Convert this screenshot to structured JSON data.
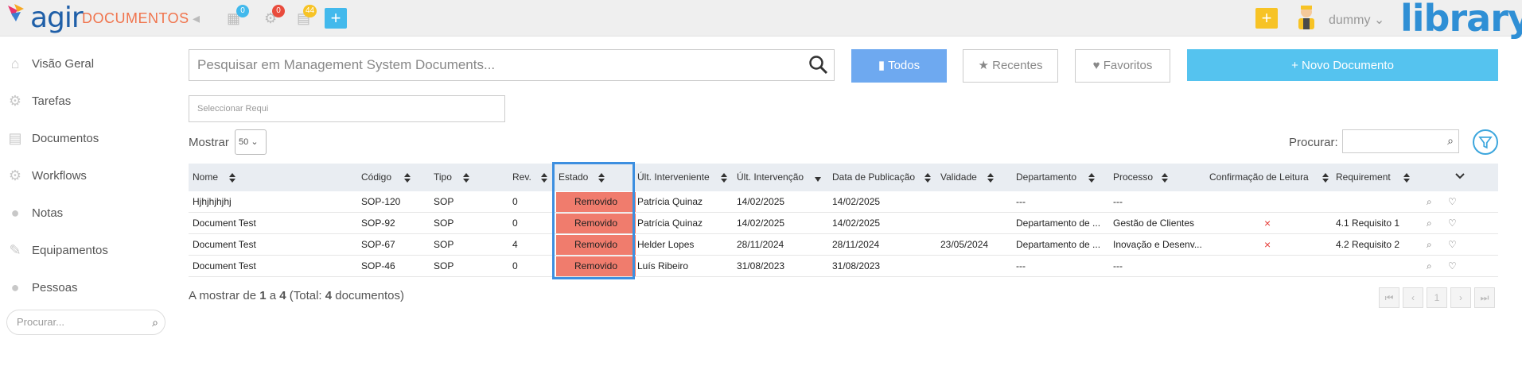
{
  "app": {
    "logo_text": "agir",
    "title": "DOCUMENTOS",
    "brand": "library",
    "user": "dummy",
    "badges": {
      "calendar": "0",
      "settings": "0",
      "docs": "44"
    },
    "colors": {
      "accent": "#f0744d",
      "brand": "#2f8fd5",
      "removed": "#f07c6d"
    }
  },
  "sidebar": {
    "items": [
      {
        "label": "Visão Geral",
        "icon": "home-icon"
      },
      {
        "label": "Tarefas",
        "icon": "gear-icon"
      },
      {
        "label": "Documentos",
        "icon": "document-icon"
      },
      {
        "label": "Workflows",
        "icon": "workflow-icon"
      },
      {
        "label": "Notas",
        "icon": "comments-icon"
      },
      {
        "label": "Equipamentos",
        "icon": "wrench-icon"
      },
      {
        "label": "Pessoas",
        "icon": "user-icon"
      }
    ],
    "search_placeholder": "Procurar..."
  },
  "toolbar": {
    "search_placeholder": "Pesquisar em Management System Documents...",
    "filters": {
      "all": "Todos",
      "recent": "Recentes",
      "favorites": "Favoritos"
    },
    "new_doc": "Novo Documento",
    "requirement_placeholder": "Seleccionar Requi",
    "show_label": "Mostrar",
    "show_value": "50",
    "search_label": "Procurar:"
  },
  "table": {
    "columns": {
      "name": "Nome",
      "code": "Código",
      "type": "Tipo",
      "rev": "Rev.",
      "state": "Estado",
      "last_user": "Últ. Interveniente",
      "last_date": "Últ. Intervenção",
      "pub_date": "Data de Publicação",
      "validity": "Validade",
      "dept": "Departamento",
      "process": "Processo",
      "read_conf": "Confirmação de Leitura",
      "requirement": "Requirement"
    },
    "rows": [
      {
        "name": "Hjhjhjhjhj",
        "code": "SOP-120",
        "type": "SOP",
        "rev": "0",
        "state": "Removido",
        "last_user": "Patrícia Quinaz",
        "last_date": "14/02/2025",
        "pub_date": "14/02/2025",
        "validity": "",
        "dept": "---",
        "process": "---",
        "read_conf": "",
        "requirement": ""
      },
      {
        "name": "Document Test",
        "code": "SOP-92",
        "type": "SOP",
        "rev": "0",
        "state": "Removido",
        "last_user": "Patrícia Quinaz",
        "last_date": "14/02/2025",
        "pub_date": "14/02/2025",
        "validity": "",
        "dept": "Departamento de ...",
        "process": "Gestão de Clientes",
        "read_conf": "×",
        "requirement": "4.1 Requisito 1"
      },
      {
        "name": "Document Test",
        "code": "SOP-67",
        "type": "SOP",
        "rev": "4",
        "state": "Removido",
        "last_user": "Helder Lopes",
        "last_date": "28/11/2024",
        "pub_date": "28/11/2024",
        "validity": "23/05/2024",
        "dept": "Departamento de ...",
        "process": "Inovação e Desenv...",
        "read_conf": "×",
        "requirement": "4.2 Requisito 2"
      },
      {
        "name": "Document Test",
        "code": "SOP-46",
        "type": "SOP",
        "rev": "0",
        "state": "Removido",
        "last_user": "Luís Ribeiro",
        "last_date": "31/08/2023",
        "pub_date": "31/08/2023",
        "validity": "",
        "dept": "---",
        "process": "---",
        "read_conf": "",
        "requirement": ""
      }
    ]
  },
  "footer": {
    "prefix": "A mostrar de ",
    "from": "1",
    "mid": " a ",
    "to": "4",
    "total_prefix": " (Total: ",
    "total": "4",
    "total_suffix": " documentos)",
    "current_page": "1"
  }
}
